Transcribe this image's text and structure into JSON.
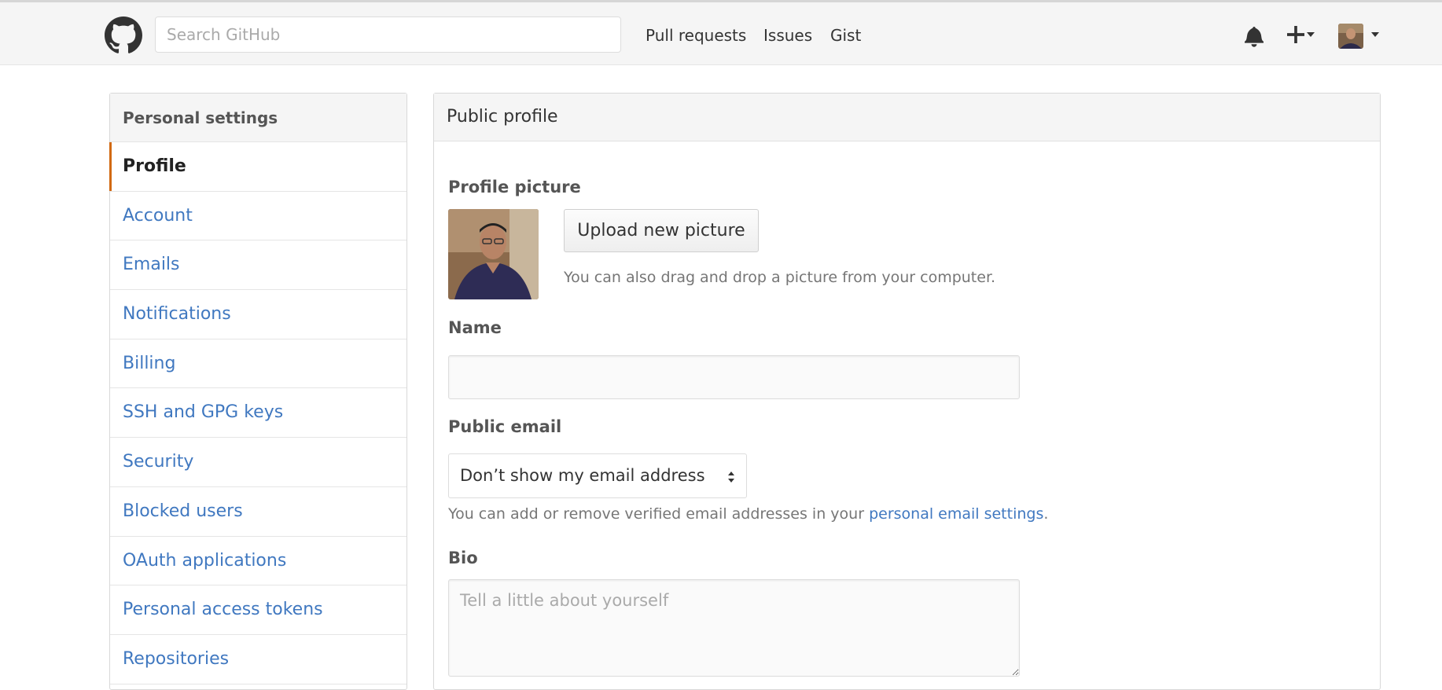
{
  "header": {
    "search_placeholder": "Search GitHub",
    "nav": [
      "Pull requests",
      "Issues",
      "Gist"
    ],
    "icons": [
      "github-logo",
      "bell-icon",
      "plus-icon",
      "avatar"
    ]
  },
  "sidebar": {
    "title": "Personal settings",
    "items": [
      {
        "label": "Profile",
        "active": true
      },
      {
        "label": "Account"
      },
      {
        "label": "Emails"
      },
      {
        "label": "Notifications"
      },
      {
        "label": "Billing"
      },
      {
        "label": "SSH and GPG keys"
      },
      {
        "label": "Security"
      },
      {
        "label": "Blocked users"
      },
      {
        "label": "OAuth applications"
      },
      {
        "label": "Personal access tokens"
      },
      {
        "label": "Repositories"
      }
    ]
  },
  "main": {
    "title": "Public profile",
    "picture_label": "Profile picture",
    "upload_button": "Upload new picture",
    "upload_note": "You can also drag and drop a picture from your computer.",
    "name_label": "Name",
    "name_value": "",
    "email_label": "Public email",
    "email_select": "Don’t show my email address",
    "email_note_pre": "You can add or remove verified email addresses in your",
    "email_note_link": "personal email settings",
    "email_note_post": ".",
    "bio_label": "Bio",
    "bio_placeholder": "Tell a little about yourself"
  },
  "colors": {
    "link": "#4078c0",
    "active_marker": "#d26911"
  }
}
